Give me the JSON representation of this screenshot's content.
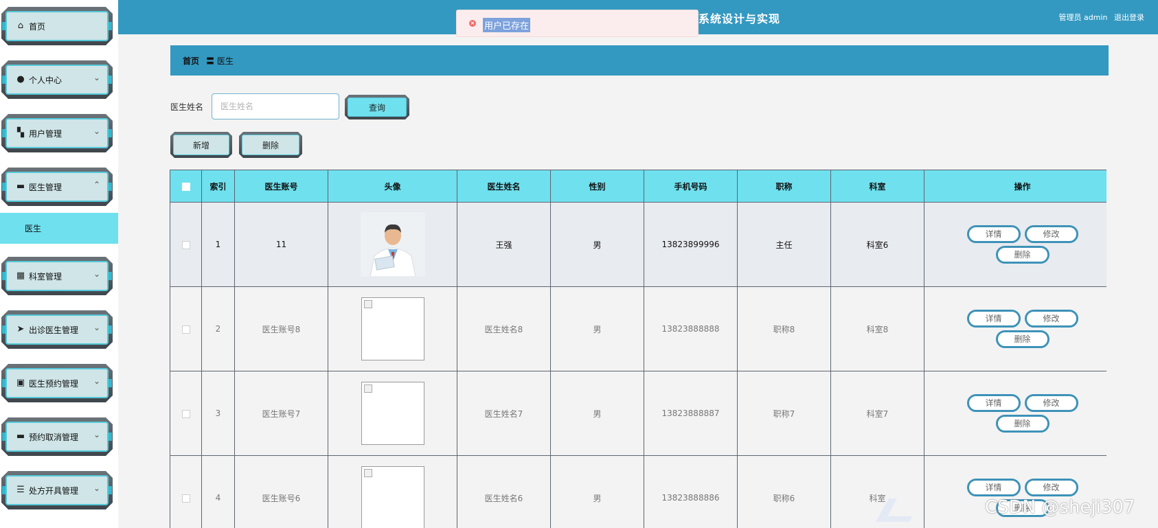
{
  "header": {
    "title": "系统设计与实现",
    "user_label": "管理员 admin",
    "logout_label": "退出登录"
  },
  "toast": {
    "message": "用户已存在"
  },
  "sidebar": {
    "items": [
      {
        "label": "首页",
        "icon": "home-icon",
        "has_arrow": false
      },
      {
        "label": "个人中心",
        "icon": "user-icon",
        "has_arrow": true
      },
      {
        "label": "用户管理",
        "icon": "user-card-icon",
        "has_arrow": true
      },
      {
        "label": "医生管理",
        "icon": "message-icon",
        "has_arrow": true
      },
      {
        "label": "科室管理",
        "icon": "grid-icon",
        "has_arrow": true
      },
      {
        "label": "出诊医生管理",
        "icon": "send-icon",
        "has_arrow": true
      },
      {
        "label": "医生预约管理",
        "icon": "calendar-x-icon",
        "has_arrow": true
      },
      {
        "label": "预约取消管理",
        "icon": "briefcase-icon",
        "has_arrow": true
      },
      {
        "label": "处方开具管理",
        "icon": "list-icon",
        "has_arrow": true
      }
    ],
    "sub_item": "医生"
  },
  "breadcrumb": {
    "home": "首页",
    "separator": "〓",
    "current": "医生"
  },
  "search": {
    "label": "医生姓名",
    "placeholder": "医生姓名",
    "query_label": "查询"
  },
  "actions": {
    "add_label": "新增",
    "delete_label": "删除"
  },
  "table": {
    "headers": [
      "",
      "索引",
      "医生账号",
      "头像",
      "医生姓名",
      "性别",
      "手机号码",
      "职称",
      "科室",
      "操作"
    ],
    "rows": [
      {
        "index": "1",
        "account": "11",
        "name": "王强",
        "gender": "男",
        "phone": "13823899996",
        "title": "主任",
        "dept": "科室6"
      },
      {
        "index": "2",
        "account": "医生账号8",
        "name": "医生姓名8",
        "gender": "男",
        "phone": "13823888888",
        "title": "职称8",
        "dept": "科室8"
      },
      {
        "index": "3",
        "account": "医生账号7",
        "name": "医生姓名7",
        "gender": "男",
        "phone": "13823888887",
        "title": "职称7",
        "dept": "科室7"
      },
      {
        "index": "4",
        "account": "医生账号6",
        "name": "医生姓名6",
        "gender": "男",
        "phone": "13823888886",
        "title": "职称6",
        "dept": "科室"
      }
    ],
    "op_labels": {
      "detail": "详情",
      "edit": "修改",
      "delete": "删除"
    }
  },
  "watermark": "CSDN @sheji307"
}
